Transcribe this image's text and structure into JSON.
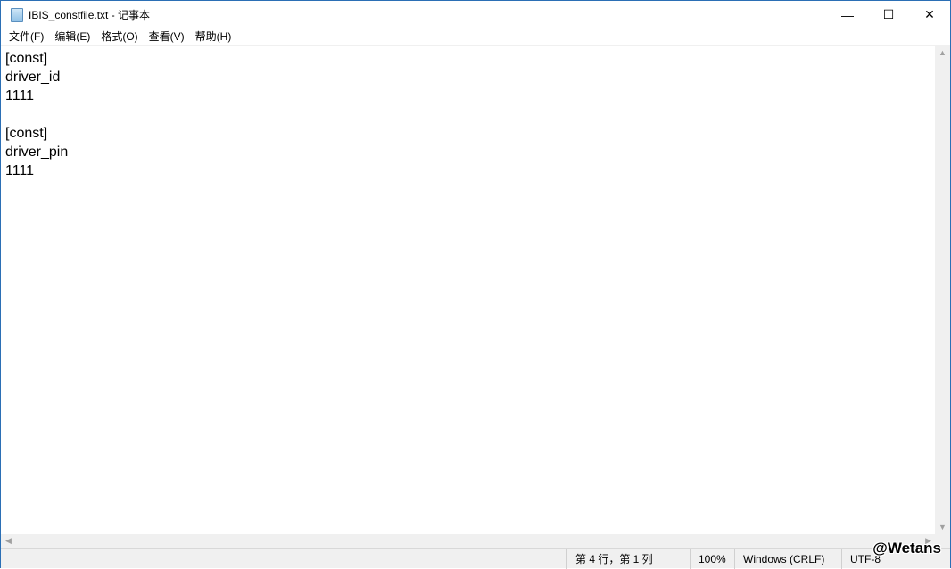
{
  "window": {
    "title": "IBIS_constfile.txt - 记事本",
    "minimize": "—",
    "maximize": "☐",
    "close": "✕"
  },
  "menu": [
    "文件(F)",
    "编辑(E)",
    "格式(O)",
    "查看(V)",
    "帮助(H)"
  ],
  "editor": {
    "content": "[const]\ndriver_id\n1111\n\n[const]\ndriver_pin\n1111"
  },
  "status": {
    "position": "第 4 行，第 1 列",
    "zoom": "100%",
    "line_ending": "Windows (CRLF)",
    "encoding": "UTF-8"
  },
  "watermark": "@Wetans"
}
